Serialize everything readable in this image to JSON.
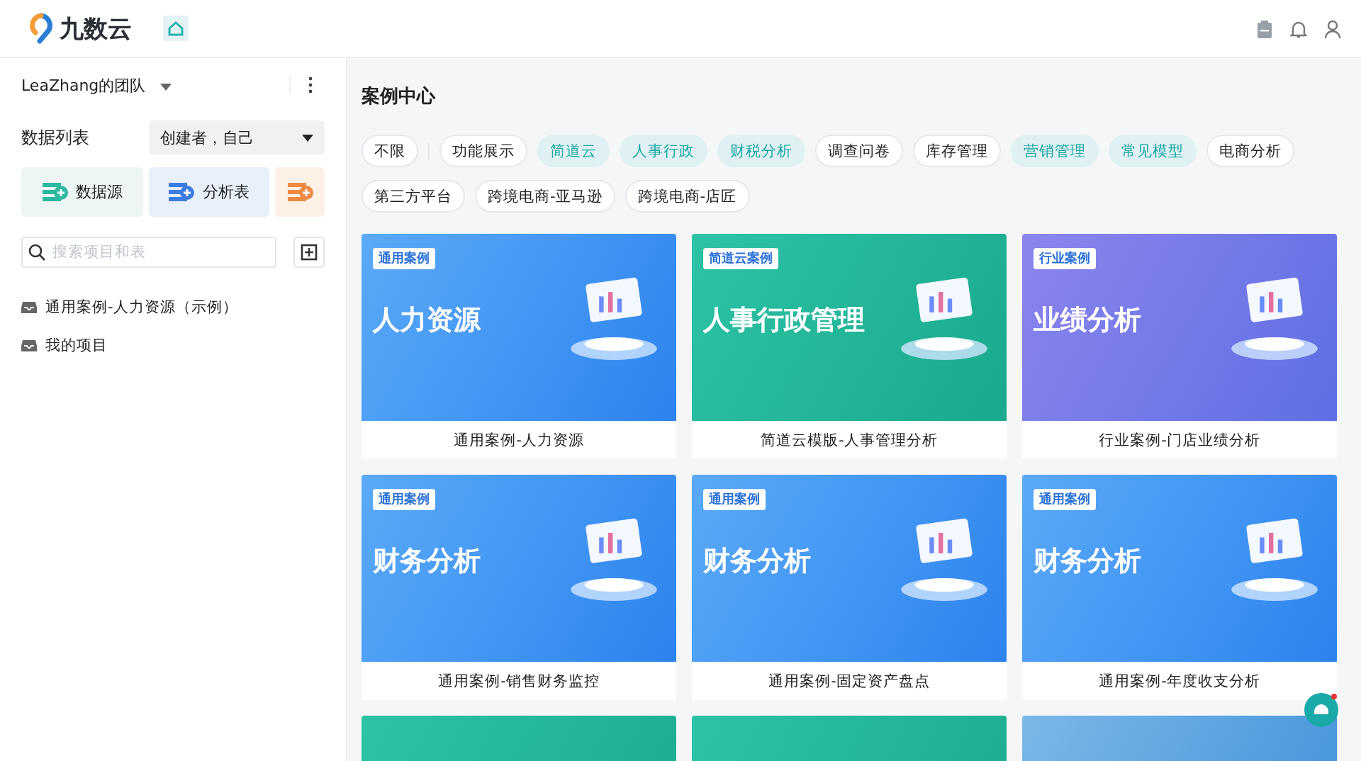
{
  "header": {
    "brand": "九数云"
  },
  "sidebar": {
    "team": "LeaZhang的团队",
    "list_title": "数据列表",
    "filter": "创建者，自己",
    "actions": [
      {
        "kind": "source",
        "label": "数据源"
      },
      {
        "kind": "analysis",
        "label": "分析表"
      },
      {
        "kind": "orange"
      }
    ],
    "search": {
      "placeholder": "搜索项目和表"
    },
    "projects": [
      {
        "label": "通用案例-人力资源（示例）"
      },
      {
        "label": "我的项目"
      }
    ]
  },
  "main": {
    "title": "案例中心",
    "chips": [
      {
        "label": "不限",
        "highlighted": false
      },
      {
        "label": "功能展示",
        "highlighted": false
      },
      {
        "label": "简道云",
        "highlighted": true
      },
      {
        "label": "人事行政",
        "highlighted": true
      },
      {
        "label": "财税分析",
        "highlighted": true
      },
      {
        "label": "调查问卷",
        "highlighted": false
      },
      {
        "label": "库存管理",
        "highlighted": false
      },
      {
        "label": "营销管理",
        "highlighted": true
      },
      {
        "label": "常见模型",
        "highlighted": true
      },
      {
        "label": "电商分析",
        "highlighted": false
      },
      {
        "label": "第三方平台",
        "highlighted": false
      },
      {
        "label": "跨境电商-亚马逊",
        "highlighted": false
      },
      {
        "label": "跨境电商-店匠",
        "highlighted": false
      }
    ],
    "cards": [
      {
        "kind": "blue",
        "tag": "通用案例",
        "banner": "人力资源",
        "caption": "通用案例-人力资源"
      },
      {
        "kind": "teal",
        "tag": "简道云案例",
        "banner": "人事行政管理",
        "caption": "简道云模版-人事管理分析"
      },
      {
        "kind": "purple",
        "tag": "行业案例",
        "banner": "业绩分析",
        "caption": "行业案例-门店业绩分析"
      },
      {
        "kind": "blue",
        "tag": "通用案例",
        "banner": "财务分析",
        "caption": "通用案例-销售财务监控"
      },
      {
        "kind": "blue",
        "tag": "通用案例",
        "banner": "财务分析",
        "caption": "通用案例-固定资产盘点"
      },
      {
        "kind": "blue",
        "tag": "通用案例",
        "banner": "财务分析",
        "caption": "通用案例-年度收支分析"
      },
      {
        "kind": "teal"
      },
      {
        "kind": "teal"
      },
      {
        "kind": "skyblue"
      }
    ]
  }
}
